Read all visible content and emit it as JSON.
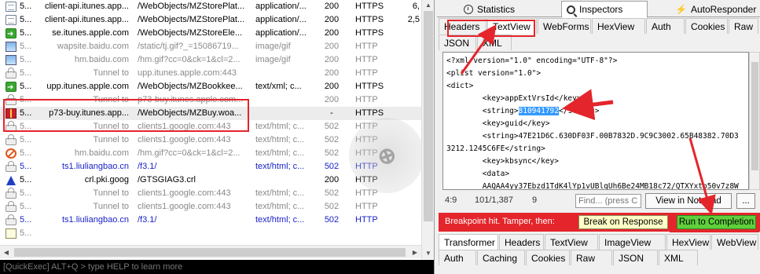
{
  "sessions": {
    "rows": [
      {
        "icon": "doc-icon",
        "num": "5...",
        "host": "client-api.itunes.app...",
        "url": "/WebObjects/MZStorePlat...",
        "ct": "application/...",
        "result": "200",
        "proto": "HTTPS",
        "size": "6,",
        "style": "normal"
      },
      {
        "icon": "doc-icon",
        "num": "5...",
        "host": "client-api.itunes.app...",
        "url": "/WebObjects/MZStorePlat...",
        "ct": "application/...",
        "result": "200",
        "proto": "HTTPS",
        "size": "2,5",
        "style": "normal"
      },
      {
        "icon": "arrow-icon",
        "num": "5...",
        "host": "se.itunes.apple.com",
        "url": "/WebObjects/MZStoreEle...",
        "ct": "application/...",
        "result": "200",
        "proto": "HTTPS",
        "size": "",
        "style": "normal"
      },
      {
        "icon": "image-icon",
        "num": "5...",
        "host": "wapsite.baidu.com",
        "url": "/static/tj.gif?_=15086719...",
        "ct": "image/gif",
        "result": "200",
        "proto": "HTTP",
        "size": "",
        "style": "grey"
      },
      {
        "icon": "image-icon",
        "num": "5...",
        "host": "hm.baidu.com",
        "url": "/hm.gif?cc=0&ck=1&cl=2...",
        "ct": "image/gif",
        "result": "200",
        "proto": "HTTP",
        "size": "",
        "style": "grey"
      },
      {
        "icon": "lock-icon",
        "num": "5...",
        "host": "Tunnel to",
        "url": "upp.itunes.apple.com:443",
        "ct": "",
        "result": "200",
        "proto": "HTTP",
        "size": "",
        "style": "grey"
      },
      {
        "icon": "arrow-icon",
        "num": "5...",
        "host": "upp.itunes.apple.com",
        "url": "/WebObjects/MZBookkee...",
        "ct": "text/xml; c...",
        "result": "200",
        "proto": "HTTPS",
        "size": "",
        "style": "normal"
      },
      {
        "icon": "lock-icon",
        "num": "5...",
        "host": "Tunnel to",
        "url": "p73-buy.itunes.apple.com...",
        "ct": "",
        "result": "200",
        "proto": "HTTP",
        "size": "",
        "style": "grey"
      },
      {
        "icon": "gift-icon",
        "num": "5...",
        "host": "p73-buy.itunes.app...",
        "url": "/WebObjects/MZBuy.woa...",
        "ct": "",
        "result": "-",
        "proto": "HTTPS",
        "size": "",
        "style": "normal"
      },
      {
        "icon": "lock-icon",
        "num": "5...",
        "host": "Tunnel to",
        "url": "clients1.google.com:443",
        "ct": "text/html; c...",
        "result": "502",
        "proto": "HTTP",
        "size": "",
        "style": "grey"
      },
      {
        "icon": "lock-icon",
        "num": "5...",
        "host": "Tunnel to",
        "url": "clients1.google.com:443",
        "ct": "text/html; c...",
        "result": "502",
        "proto": "HTTP",
        "size": "",
        "style": "grey"
      },
      {
        "icon": "block-icon",
        "num": "5...",
        "host": "hm.baidu.com",
        "url": "/hm.gif?cc=0&ck=1&cl=2...",
        "ct": "text/html; c...",
        "result": "502",
        "proto": "HTTP",
        "size": "",
        "style": "grey"
      },
      {
        "icon": "lock-icon",
        "num": "5...",
        "host": "ts1.liuliangbao.cn",
        "url": "/f3.1/",
        "ct": "text/html; c...",
        "result": "502",
        "proto": "HTTP",
        "size": "",
        "style": "blue"
      },
      {
        "icon": "up-icon",
        "num": "5...",
        "host": "crl.pki.goog",
        "url": "/GTSGIAG3.crl",
        "ct": "",
        "result": "200",
        "proto": "HTTP",
        "size": "",
        "style": "normal"
      },
      {
        "icon": "lock-icon",
        "num": "5...",
        "host": "Tunnel to",
        "url": "clients1.google.com:443",
        "ct": "text/html; c...",
        "result": "502",
        "proto": "HTTP",
        "size": "",
        "style": "grey"
      },
      {
        "icon": "lock-icon",
        "num": "5...",
        "host": "Tunnel to",
        "url": "clients1.google.com:443",
        "ct": "text/html; c...",
        "result": "502",
        "proto": "HTTP",
        "size": "",
        "style": "grey"
      },
      {
        "icon": "lock-icon",
        "num": "5...",
        "host": "ts1.liuliangbao.cn",
        "url": "/f3.1/",
        "ct": "text/html; c...",
        "result": "502",
        "proto": "HTTP",
        "size": "",
        "style": "blue"
      },
      {
        "icon": "script-icon",
        "num": "5...",
        "host": "",
        "url": "",
        "ct": "",
        "result": "",
        "proto": "",
        "size": "",
        "style": "grey"
      }
    ],
    "quickexec": "[QuickExec] ALT+Q > type HELP to learn more"
  },
  "inspector": {
    "top_tabs": [
      "Statistics",
      "Inspectors",
      "AutoResponder"
    ],
    "request_tabs_row1": [
      "Headers",
      "TextView",
      "WebForms",
      "HexView",
      "Auth",
      "Cookies",
      "Raw"
    ],
    "request_tabs_row2": [
      "JSON",
      "XML"
    ],
    "xml_lines": [
      "<?xml version=\"1.0\" encoding=\"UTF-8\"?>",
      "<plist version=\"1.0\">",
      "<dict>",
      "        <key>appExtVrsId</key>"
    ],
    "xml_string_open": "        <string>",
    "xml_highlight": "810941792",
    "xml_string_close": "</string>",
    "xml_lines_after": [
      "        <key>guid</key>",
      "        <string>47E21D6C.630DF03F.00B7832D.9C9C3002.65B48382.70D3",
      "3212.1245C6FE</string>",
      "        <key>kbsync</key>",
      "        <data>",
      "        AAQAA4yy37Ebzd1TdK4lYp1vUBlqUh6Be24MB18c72/QTXYxtp50v7z8W",
      "        RtnAl9cDzE"
    ],
    "status": {
      "pos": "4:9",
      "count": "101/1,387",
      "col": "9",
      "find_placeholder": "Find... (press C",
      "view_notepad": "View in Notepad",
      "more": "..."
    },
    "breakpoint": {
      "label": "Breakpoint hit. Tamper, then:",
      "break_response": "Break on Response",
      "run_completion": "Run to Completion"
    },
    "response_tabs_row1": [
      "Transformer",
      "Headers",
      "TextView",
      "ImageView",
      "HexView",
      "WebView"
    ],
    "response_tabs_row2": [
      "Auth",
      "Caching",
      "Cookies",
      "Raw",
      "JSON",
      "XML"
    ]
  },
  "colors": {
    "annotation_red": "#e4252b",
    "run_green": "#5fd03c",
    "break_yellow": "#ffffc6",
    "link_blue": "#1a22c8"
  }
}
